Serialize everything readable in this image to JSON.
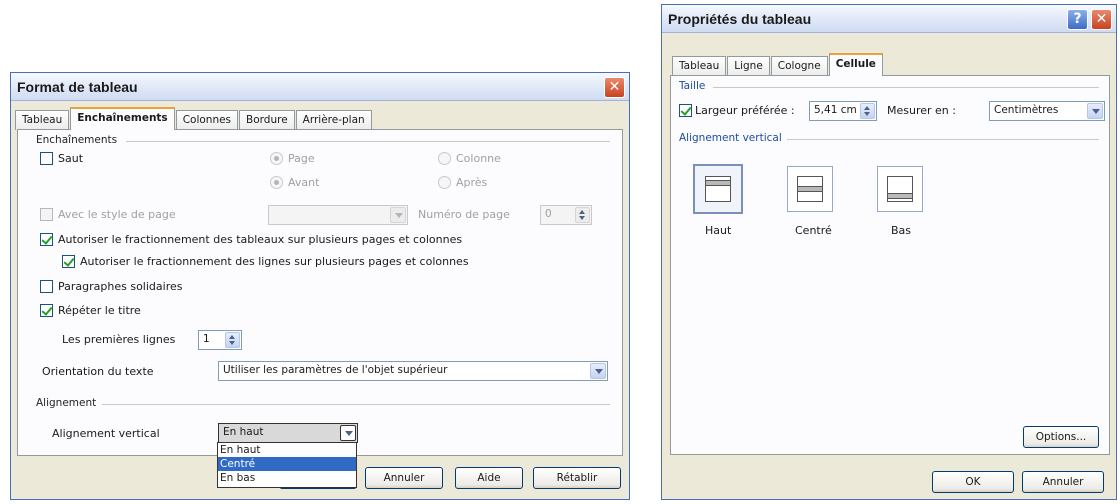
{
  "left_dialog": {
    "title": "Format de tableau",
    "tabs": [
      "Tableau",
      "Enchaînements",
      "Colonnes",
      "Bordure",
      "Arrière-plan"
    ],
    "active_tab": "Enchaînements",
    "enchainements": {
      "group_label": "Enchaînements",
      "saut_label": "Saut",
      "saut_checked": false,
      "radio_page": "Page",
      "radio_colonne": "Colonne",
      "radio_avant": "Avant",
      "radio_apres": "Après",
      "avec_style_label": "Avec le style de page",
      "avec_style_value": "",
      "numero_page_label": "Numéro de page",
      "numero_page_value": "0",
      "autoriser_tableaux_label": "Autoriser le fractionnement des tableaux sur plusieurs pages et colonnes",
      "autoriser_tableaux_checked": true,
      "autoriser_lignes_label": "Autoriser le fractionnement des lignes sur plusieurs pages et colonnes",
      "autoriser_lignes_checked": true,
      "paragraphes_label": "Paragraphes solidaires",
      "paragraphes_checked": false,
      "repeter_label": "Répéter le titre",
      "repeter_checked": true,
      "premieres_lignes_label": "Les premières lignes",
      "premieres_lignes_value": "1",
      "orientation_label": "Orientation du texte",
      "orientation_value": "Utiliser les paramètres de l'objet supérieur"
    },
    "alignement": {
      "group_label": "Alignement",
      "vertical_label": "Alignement vertical",
      "vertical_value": "En haut",
      "options": [
        "En haut",
        "Centré",
        "En bas"
      ],
      "highlighted": "Centré"
    },
    "buttons": {
      "annuler": "Annuler",
      "aide": "Aide",
      "retablir": "Rétablir"
    },
    "colors": {
      "title_bar": "#dfe8f7",
      "close_button": "#c8421f",
      "active_tab_accent": "#e8a33b",
      "selection": "#316ac5"
    }
  },
  "right_dialog": {
    "title": "Propriétés du tableau",
    "help_glyph": "?",
    "close_glyph": "✕",
    "tabs": [
      "Tableau",
      "Ligne",
      "Cologne",
      "Cellule"
    ],
    "active_tab": "Cellule",
    "taille": {
      "group_label": "Taille",
      "largeur_label": "Largeur préférée :",
      "largeur_checked": true,
      "largeur_value": "5,41 cm",
      "mesurer_label": "Mesurer en :",
      "mesurer_value": "Centimètres"
    },
    "alignement_vertical": {
      "group_label": "Alignement vertical",
      "haut": "Haut",
      "centre": "Centré",
      "bas": "Bas",
      "selected": "Haut"
    },
    "buttons": {
      "options": "Options...",
      "ok": "OK",
      "annuler": "Annuler"
    }
  }
}
